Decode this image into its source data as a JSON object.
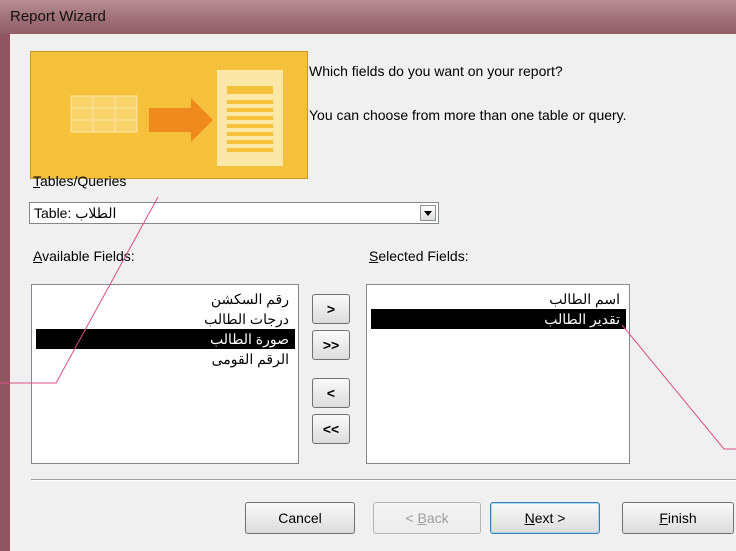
{
  "window": {
    "title": "Report Wizard"
  },
  "intro": {
    "question": "Which fields do you want on your report?",
    "hint": "You can choose from more than one table or query."
  },
  "tables": {
    "label_key": "T",
    "label_rest": "ables/Queries",
    "selected": "Table: الطلاب"
  },
  "available": {
    "label_key": "A",
    "label_rest": "vailable Fields:",
    "items": [
      "رقم السكشن",
      "درجات الطالب",
      "صورة الطالب",
      "الرقم القومى"
    ],
    "selected_index": 2
  },
  "selected_fields": {
    "label_key": "S",
    "label_rest": "elected Fields:",
    "items": [
      "اسم الطالب",
      "تقدير الطالب"
    ],
    "selected_index": 1
  },
  "move_buttons": {
    "add": ">",
    "add_all": ">>",
    "remove": "<",
    "remove_all": "<<"
  },
  "footer": {
    "cancel": "Cancel",
    "back_pre": "< ",
    "back_key": "B",
    "back_rest": "ack",
    "next_key": "N",
    "next_rest": "ext >",
    "finish_key": "F",
    "finish_rest": "inish"
  },
  "colors": {
    "accent_yellow": "#f5c13a",
    "accent_orange": "#f08a1e",
    "selection": "#000000",
    "annotation": "#d94f8a"
  }
}
